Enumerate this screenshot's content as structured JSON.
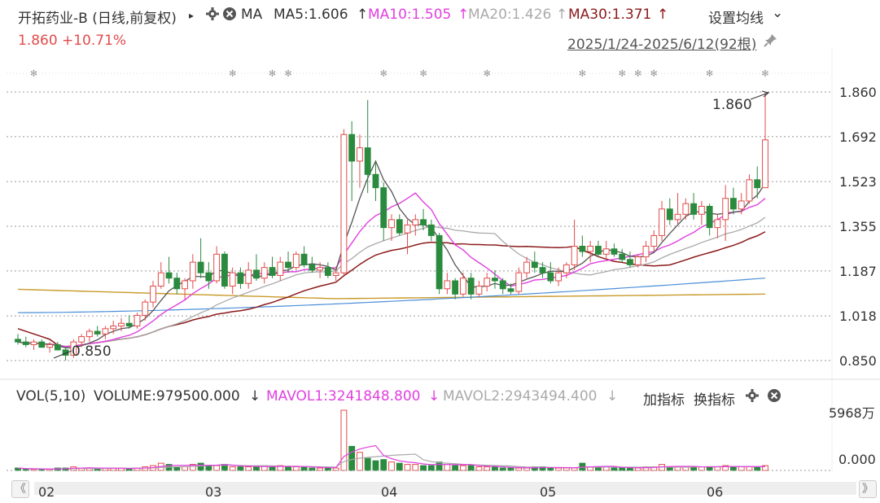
{
  "header": {
    "stock_name": "开拓药业-B (日线,前复权)",
    "expand_arrow": "▸",
    "ma_label": "MA",
    "ma5": "MA5:1.606",
    "ma10": "MA10:1.505",
    "ma20": "MA20:1.426",
    "ma30": "MA30:1.371",
    "up_arrow": "↑",
    "settings_label": "设置均线",
    "settings_arrow": "⌄"
  },
  "price": {
    "last": "1.860",
    "change": "+10.71%"
  },
  "range": {
    "text": "2025/1/24-2025/6/12(92根)"
  },
  "annotations": {
    "high": "1.860",
    "low": "0.850"
  },
  "y_axis": [
    "1.860",
    "1.692",
    "1.523",
    "1.355",
    "1.187",
    "1.018",
    "0.850"
  ],
  "volume": {
    "label": "VOL(5,10)",
    "volume": "VOLUME:979500.000",
    "down_arrow": "↓",
    "mavol1": "MAVOL1:3241848.800",
    "mavol2": "MAVOL2:2943494.400",
    "add_indicator": "加指标",
    "switch_indicator": "换指标",
    "y_max": "5968万",
    "y_min": "0.000"
  },
  "x_axis": [
    "02",
    "03",
    "04",
    "05",
    "06"
  ],
  "nav": {
    "prev": "《",
    "next": "》"
  },
  "colors": {
    "up": "#e24b4b",
    "down": "#2a8a3e",
    "ma5": "#555555",
    "ma10": "#e040e0",
    "ma20": "#aaaaaa",
    "ma30": "#8b1a1a",
    "ma60": "#4a8ed8",
    "ma120": "#c89a2a"
  },
  "chart_data": {
    "type": "candlestick",
    "ylim": [
      0.85,
      1.86
    ],
    "candles": [
      {
        "o": 0.93,
        "h": 0.95,
        "l": 0.91,
        "c": 0.92
      },
      {
        "o": 0.92,
        "h": 0.94,
        "l": 0.9,
        "c": 0.91
      },
      {
        "o": 0.91,
        "h": 0.93,
        "l": 0.89,
        "c": 0.92
      },
      {
        "o": 0.92,
        "h": 0.93,
        "l": 0.9,
        "c": 0.9
      },
      {
        "o": 0.9,
        "h": 0.92,
        "l": 0.88,
        "c": 0.91
      },
      {
        "o": 0.91,
        "h": 0.92,
        "l": 0.89,
        "c": 0.89
      },
      {
        "o": 0.89,
        "h": 0.9,
        "l": 0.85,
        "c": 0.87
      },
      {
        "o": 0.87,
        "h": 0.93,
        "l": 0.86,
        "c": 0.92
      },
      {
        "o": 0.92,
        "h": 0.95,
        "l": 0.9,
        "c": 0.94
      },
      {
        "o": 0.94,
        "h": 0.97,
        "l": 0.92,
        "c": 0.96
      },
      {
        "o": 0.96,
        "h": 0.98,
        "l": 0.94,
        "c": 0.95
      },
      {
        "o": 0.95,
        "h": 0.98,
        "l": 0.93,
        "c": 0.97
      },
      {
        "o": 0.97,
        "h": 1.0,
        "l": 0.95,
        "c": 0.98
      },
      {
        "o": 0.98,
        "h": 1.01,
        "l": 0.96,
        "c": 0.99
      },
      {
        "o": 0.99,
        "h": 1.02,
        "l": 0.97,
        "c": 0.98
      },
      {
        "o": 0.98,
        "h": 1.03,
        "l": 0.97,
        "c": 1.02
      },
      {
        "o": 1.02,
        "h": 1.08,
        "l": 1.0,
        "c": 1.07
      },
      {
        "o": 1.07,
        "h": 1.15,
        "l": 1.05,
        "c": 1.13
      },
      {
        "o": 1.13,
        "h": 1.22,
        "l": 1.12,
        "c": 1.18
      },
      {
        "o": 1.18,
        "h": 1.24,
        "l": 1.14,
        "c": 1.16
      },
      {
        "o": 1.16,
        "h": 1.18,
        "l": 1.1,
        "c": 1.12
      },
      {
        "o": 1.12,
        "h": 1.16,
        "l": 1.08,
        "c": 1.15
      },
      {
        "o": 1.15,
        "h": 1.25,
        "l": 1.12,
        "c": 1.22
      },
      {
        "o": 1.22,
        "h": 1.31,
        "l": 1.16,
        "c": 1.18
      },
      {
        "o": 1.18,
        "h": 1.22,
        "l": 1.12,
        "c": 1.15
      },
      {
        "o": 1.15,
        "h": 1.28,
        "l": 1.14,
        "c": 1.25
      },
      {
        "o": 1.25,
        "h": 1.26,
        "l": 1.12,
        "c": 1.13
      },
      {
        "o": 1.13,
        "h": 1.2,
        "l": 1.1,
        "c": 1.18
      },
      {
        "o": 1.18,
        "h": 1.2,
        "l": 1.12,
        "c": 1.14
      },
      {
        "o": 1.14,
        "h": 1.22,
        "l": 1.12,
        "c": 1.19
      },
      {
        "o": 1.19,
        "h": 1.25,
        "l": 1.15,
        "c": 1.16
      },
      {
        "o": 1.16,
        "h": 1.22,
        "l": 1.14,
        "c": 1.2
      },
      {
        "o": 1.2,
        "h": 1.24,
        "l": 1.16,
        "c": 1.17
      },
      {
        "o": 1.17,
        "h": 1.24,
        "l": 1.15,
        "c": 1.22
      },
      {
        "o": 1.22,
        "h": 1.26,
        "l": 1.18,
        "c": 1.2
      },
      {
        "o": 1.2,
        "h": 1.26,
        "l": 1.19,
        "c": 1.25
      },
      {
        "o": 1.25,
        "h": 1.28,
        "l": 1.2,
        "c": 1.21
      },
      {
        "o": 1.21,
        "h": 1.24,
        "l": 1.18,
        "c": 1.19
      },
      {
        "o": 1.19,
        "h": 1.22,
        "l": 1.16,
        "c": 1.2
      },
      {
        "o": 1.2,
        "h": 1.22,
        "l": 1.16,
        "c": 1.17
      },
      {
        "o": 1.17,
        "h": 1.2,
        "l": 1.15,
        "c": 1.18
      },
      {
        "o": 1.18,
        "h": 1.72,
        "l": 1.17,
        "c": 1.7
      },
      {
        "o": 1.7,
        "h": 1.75,
        "l": 1.45,
        "c": 1.6
      },
      {
        "o": 1.6,
        "h": 1.7,
        "l": 1.5,
        "c": 1.65
      },
      {
        "o": 1.65,
        "h": 1.83,
        "l": 1.48,
        "c": 1.55
      },
      {
        "o": 1.55,
        "h": 1.6,
        "l": 1.45,
        "c": 1.5
      },
      {
        "o": 1.5,
        "h": 1.52,
        "l": 1.3,
        "c": 1.35
      },
      {
        "o": 1.35,
        "h": 1.4,
        "l": 1.3,
        "c": 1.38
      },
      {
        "o": 1.38,
        "h": 1.4,
        "l": 1.32,
        "c": 1.33
      },
      {
        "o": 1.33,
        "h": 1.38,
        "l": 1.25,
        "c": 1.36
      },
      {
        "o": 1.36,
        "h": 1.4,
        "l": 1.32,
        "c": 1.38
      },
      {
        "o": 1.38,
        "h": 1.42,
        "l": 1.34,
        "c": 1.36
      },
      {
        "o": 1.36,
        "h": 1.38,
        "l": 1.3,
        "c": 1.32
      },
      {
        "o": 1.32,
        "h": 1.33,
        "l": 1.1,
        "c": 1.12
      },
      {
        "o": 1.12,
        "h": 1.18,
        "l": 1.1,
        "c": 1.15
      },
      {
        "o": 1.15,
        "h": 1.16,
        "l": 1.08,
        "c": 1.1
      },
      {
        "o": 1.1,
        "h": 1.18,
        "l": 1.09,
        "c": 1.16
      },
      {
        "o": 1.16,
        "h": 1.18,
        "l": 1.08,
        "c": 1.1
      },
      {
        "o": 1.1,
        "h": 1.15,
        "l": 1.09,
        "c": 1.13
      },
      {
        "o": 1.13,
        "h": 1.18,
        "l": 1.11,
        "c": 1.16
      },
      {
        "o": 1.16,
        "h": 1.19,
        "l": 1.12,
        "c": 1.15
      },
      {
        "o": 1.15,
        "h": 1.16,
        "l": 1.1,
        "c": 1.12
      },
      {
        "o": 1.12,
        "h": 1.14,
        "l": 1.1,
        "c": 1.11
      },
      {
        "o": 1.11,
        "h": 1.2,
        "l": 1.1,
        "c": 1.18
      },
      {
        "o": 1.18,
        "h": 1.24,
        "l": 1.16,
        "c": 1.22
      },
      {
        "o": 1.22,
        "h": 1.26,
        "l": 1.18,
        "c": 1.2
      },
      {
        "o": 1.2,
        "h": 1.22,
        "l": 1.16,
        "c": 1.18
      },
      {
        "o": 1.18,
        "h": 1.22,
        "l": 1.14,
        "c": 1.15
      },
      {
        "o": 1.15,
        "h": 1.2,
        "l": 1.13,
        "c": 1.18
      },
      {
        "o": 1.18,
        "h": 1.22,
        "l": 1.16,
        "c": 1.21
      },
      {
        "o": 1.21,
        "h": 1.38,
        "l": 1.19,
        "c": 1.28
      },
      {
        "o": 1.28,
        "h": 1.32,
        "l": 1.24,
        "c": 1.26
      },
      {
        "o": 1.26,
        "h": 1.3,
        "l": 1.22,
        "c": 1.28
      },
      {
        "o": 1.28,
        "h": 1.3,
        "l": 1.24,
        "c": 1.25
      },
      {
        "o": 1.25,
        "h": 1.3,
        "l": 1.23,
        "c": 1.27
      },
      {
        "o": 1.27,
        "h": 1.29,
        "l": 1.24,
        "c": 1.25
      },
      {
        "o": 1.25,
        "h": 1.27,
        "l": 1.22,
        "c": 1.23
      },
      {
        "o": 1.23,
        "h": 1.26,
        "l": 1.2,
        "c": 1.21
      },
      {
        "o": 1.21,
        "h": 1.25,
        "l": 1.2,
        "c": 1.24
      },
      {
        "o": 1.24,
        "h": 1.3,
        "l": 1.22,
        "c": 1.28
      },
      {
        "o": 1.28,
        "h": 1.34,
        "l": 1.26,
        "c": 1.32
      },
      {
        "o": 1.32,
        "h": 1.45,
        "l": 1.3,
        "c": 1.42
      },
      {
        "o": 1.42,
        "h": 1.46,
        "l": 1.36,
        "c": 1.38
      },
      {
        "o": 1.38,
        "h": 1.48,
        "l": 1.36,
        "c": 1.4
      },
      {
        "o": 1.4,
        "h": 1.46,
        "l": 1.38,
        "c": 1.44
      },
      {
        "o": 1.44,
        "h": 1.48,
        "l": 1.38,
        "c": 1.4
      },
      {
        "o": 1.4,
        "h": 1.45,
        "l": 1.36,
        "c": 1.43
      },
      {
        "o": 1.43,
        "h": 1.44,
        "l": 1.32,
        "c": 1.35
      },
      {
        "o": 1.35,
        "h": 1.4,
        "l": 1.31,
        "c": 1.38
      },
      {
        "o": 1.38,
        "h": 1.51,
        "l": 1.3,
        "c": 1.46
      },
      {
        "o": 1.46,
        "h": 1.5,
        "l": 1.4,
        "c": 1.42
      },
      {
        "o": 1.42,
        "h": 1.48,
        "l": 1.4,
        "c": 1.45
      },
      {
        "o": 1.45,
        "h": 1.55,
        "l": 1.44,
        "c": 1.53
      },
      {
        "o": 1.53,
        "h": 1.58,
        "l": 1.46,
        "c": 1.5
      },
      {
        "o": 1.5,
        "h": 1.86,
        "l": 1.5,
        "c": 1.68
      }
    ],
    "volumes": [
      2,
      1,
      1,
      1,
      1,
      2,
      2,
      3,
      2,
      2,
      1,
      2,
      2,
      2,
      1,
      2,
      3,
      4,
      6,
      5,
      3,
      3,
      5,
      6,
      4,
      4,
      5,
      3,
      3,
      3,
      3,
      4,
      3,
      4,
      3,
      3,
      3,
      2,
      2,
      2,
      2,
      50,
      20,
      15,
      10,
      8,
      9,
      7,
      6,
      5,
      5,
      4,
      4,
      7,
      5,
      4,
      4,
      4,
      3,
      3,
      3,
      2,
      2,
      2,
      2,
      3,
      3,
      2,
      2,
      2,
      2,
      6,
      3,
      3,
      3,
      2,
      2,
      2,
      2,
      3,
      3,
      5,
      3,
      3,
      3,
      3,
      3,
      3,
      3,
      4,
      3,
      3,
      3,
      3,
      4
    ],
    "vol_ylim": [
      0,
      5968
    ]
  }
}
